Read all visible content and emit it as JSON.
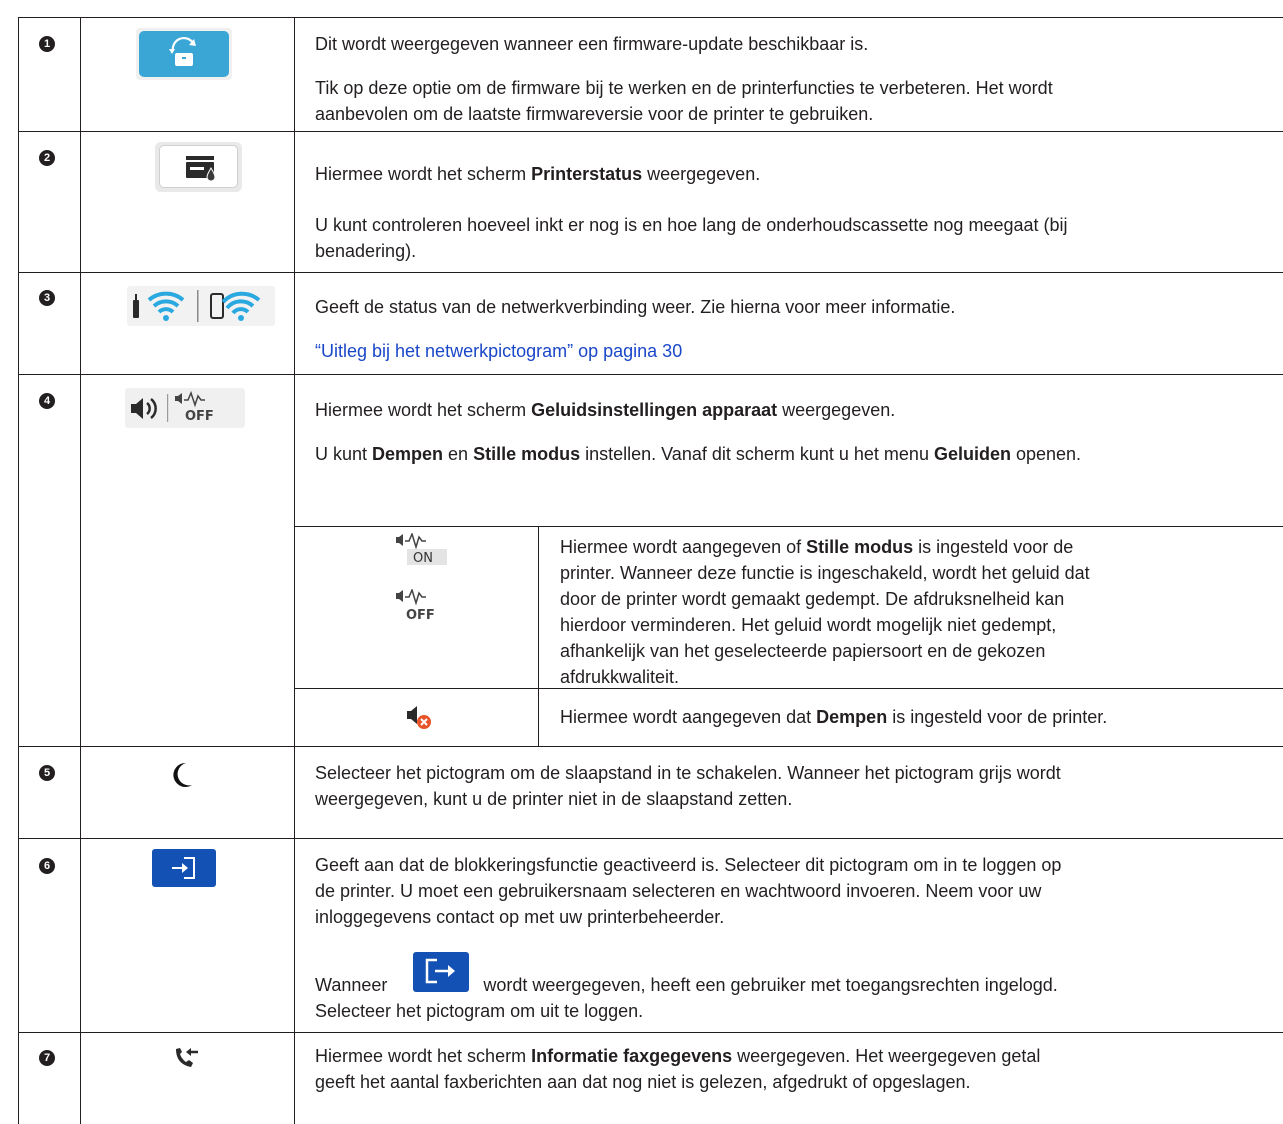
{
  "rows": [
    {
      "num": "1",
      "icon": "firmware-update-icon",
      "para1": "Dit wordt weergegeven wanneer een firmware-update beschikbaar is.",
      "para2a": "Tik op deze optie om de firmware bij te werken en de printerfuncties te verbeteren. Het wordt",
      "para2b": "aanbevolen om de laatste firmwareversie voor de printer te gebruiken."
    },
    {
      "num": "2",
      "icon": "printer-status-icon",
      "p1_before": "Hiermee wordt het scherm ",
      "p1_bold": "Printerstatus",
      "p1_after": " weergegeven.",
      "para2a": "U kunt controleren hoeveel inkt er nog is en hoe lang de onderhoudscassette nog meegaat (bij",
      "para2b": "benadering)."
    },
    {
      "num": "3",
      "icon": "network-status-icon",
      "para1": "Geeft de status van de netwerkverbinding weer. Zie hierna voor meer informatie.",
      "link": "“Uitleg bij het netwerkpictogram” op pagina 30"
    },
    {
      "num": "4",
      "icon": "sound-settings-icon",
      "p1_before": "Hiermee wordt het scherm ",
      "p1_bold": "Geluidsinstellingen apparaat",
      "p1_after": " weergegeven.",
      "p2_a": "U kunt ",
      "p2_b": "Dempen",
      "p2_c": " en ",
      "p2_d": "Stille modus",
      "p2_e": " instellen. Vanaf dit scherm kunt u het menu ",
      "p2_f": "Geluiden",
      "p2_g": " openen.",
      "sub1": {
        "on_label": "ON",
        "off_label": "OFF",
        "l1_before": "Hiermee wordt aangegeven of ",
        "l1_bold": "Stille modus",
        "l1_after": " is ingesteld voor de",
        "l2": "printer. Wanneer deze functie is ingeschakeld, wordt het geluid dat",
        "l3": "door de printer wordt gemaakt gedempt. De afdruksnelheid kan",
        "l4": "hierdoor verminderen. Het geluid wordt mogelijk niet gedempt,",
        "l5": "afhankelijk van het geselecteerde papiersoort en de gekozen",
        "l6": "afdrukkwaliteit."
      },
      "sub2": {
        "before": "Hiermee wordt aangegeven dat ",
        "bold": "Dempen",
        "after": " is ingesteld voor de printer."
      }
    },
    {
      "num": "5",
      "icon": "sleep-moon-icon",
      "l1": "Selecteer het pictogram om de slaapstand in te schakelen. Wanneer het pictogram grijs wordt",
      "l2": "weergegeven, kunt u de printer niet in de slaapstand zetten."
    },
    {
      "num": "6",
      "icon": "login-icon",
      "l1": "Geeft aan dat de blokkeringsfunctie geactiveerd is. Selecteer dit pictogram om in te loggen op",
      "l2": "de printer. U moet een gebruikersnaam selecteren en wachtwoord invoeren. Neem voor uw",
      "l3": "inloggegevens contact op met uw printerbeheerder.",
      "p2_before": "Wanneer ",
      "p2_after": " wordt weergegeven, heeft een gebruiker met toegangsrechten ingelogd.",
      "p2_l2": "Selecteer het pictogram om uit te loggen."
    },
    {
      "num": "7",
      "icon": "fax-info-icon",
      "p1_before": "Hiermee wordt het scherm ",
      "p1_bold": "Informatie faxgegevens",
      "p1_after": " weergegeven. Het weergegeven getal",
      "l2": "geeft het aantal faxberichten aan dat nog niet is gelezen, afgedrukt of opgeslagen."
    }
  ],
  "colors": {
    "accent_blue": "#1a47c8",
    "icon_blue": "#3aa6d6",
    "login_blue": "#1351b4",
    "text": "#231f20"
  }
}
